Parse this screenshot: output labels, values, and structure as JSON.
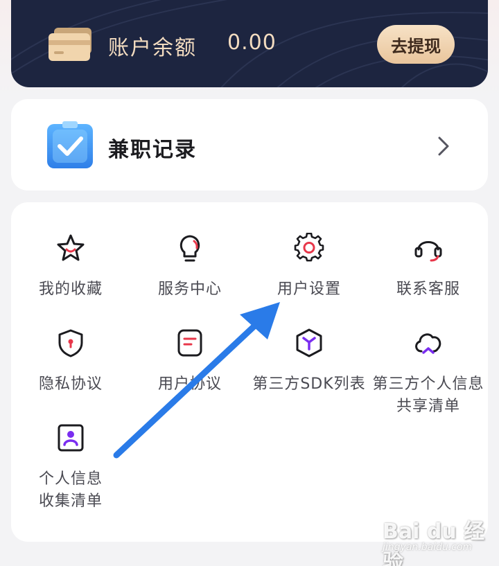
{
  "balance": {
    "label": "账户余额",
    "value": "0.00",
    "withdraw_label": "去提现"
  },
  "record": {
    "label": "兼职记录"
  },
  "menu": {
    "items": [
      {
        "label": "我的收藏",
        "icon": "star-icon"
      },
      {
        "label": "服务中心",
        "icon": "lightbulb-icon"
      },
      {
        "label": "用户设置",
        "icon": "gear-icon"
      },
      {
        "label": "联系客服",
        "icon": "headset-icon"
      },
      {
        "label": "隐私协议",
        "icon": "shield-icon"
      },
      {
        "label": "用户协议",
        "icon": "document-icon"
      },
      {
        "label": "第三方SDK列表",
        "icon": "cube-icon"
      },
      {
        "label": "第三方个人信息\n共享清单",
        "icon": "cloud-icon"
      },
      {
        "label": "个人信息\n收集清单",
        "icon": "person-card-icon"
      }
    ]
  },
  "watermark": {
    "brand": "Bai du 经验",
    "url": "jingyan.baidu.com"
  },
  "colors": {
    "card_dark": "#1d2540",
    "gold_text": "#f3dcc0",
    "accent_red": "#e8374a",
    "accent_purple": "#7a2df0",
    "annotation_arrow": "#2a7be8"
  }
}
